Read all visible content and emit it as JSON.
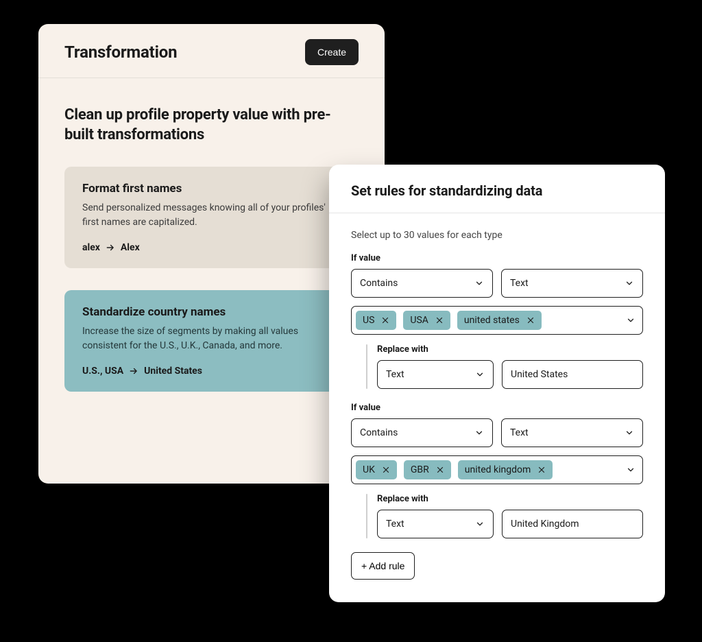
{
  "back_panel": {
    "title": "Transformation",
    "create_label": "Create",
    "subtitle": "Clean up profile property value with pre-built transformations",
    "cards": [
      {
        "title": "Format first names",
        "desc": "Send personalized messages knowing all of your profiles' first names are capitalized.",
        "example_from": "alex",
        "example_to": "Alex"
      },
      {
        "title": "Standardize country names",
        "desc": "Increase the size of segments by making all values consistent for the U.S., U.K., Canada, and more.",
        "example_from": "U.S., USA",
        "example_to": "United States"
      }
    ]
  },
  "front_panel": {
    "title": "Set rules for standardizing data",
    "hint": "Select up to 30 values for each type",
    "if_value_label": "If value",
    "replace_with_label": "Replace with",
    "contains_label": "Contains",
    "text_label": "Text",
    "add_rule_label": "+ Add rule",
    "rules": [
      {
        "tags": [
          "US",
          "USA",
          "united states"
        ],
        "replace_value": "United States"
      },
      {
        "tags": [
          "UK",
          "GBR",
          "united kingdom"
        ],
        "replace_value": "United Kingdom"
      }
    ]
  }
}
